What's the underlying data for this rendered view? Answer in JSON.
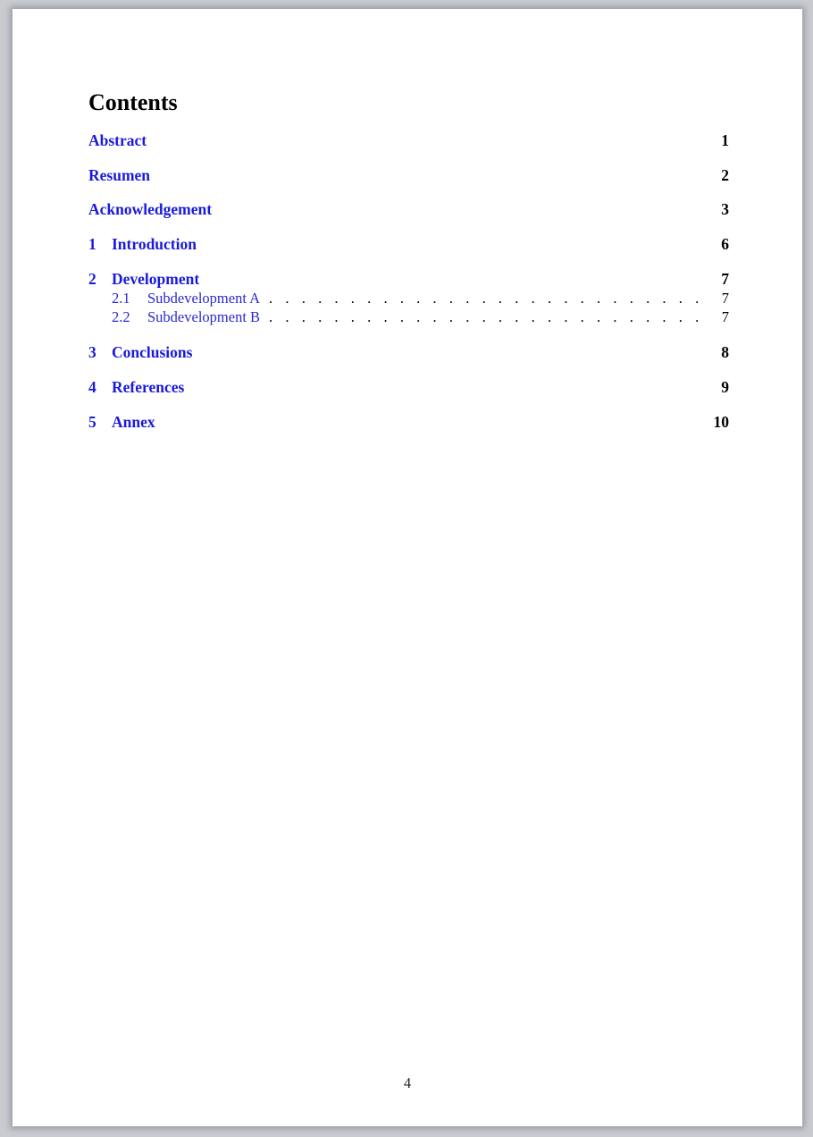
{
  "toc": {
    "title": "Contents",
    "entries": [
      {
        "num": "",
        "label": "Abstract",
        "page": "1"
      },
      {
        "num": "",
        "label": "Resumen",
        "page": "2"
      },
      {
        "num": "",
        "label": "Acknowledgement",
        "page": "3"
      },
      {
        "num": "1",
        "label": "Introduction",
        "page": "6"
      },
      {
        "num": "2",
        "label": "Development",
        "page": "7"
      },
      {
        "num": "3",
        "label": "Conclusions",
        "page": "8"
      },
      {
        "num": "4",
        "label": "References",
        "page": "9"
      },
      {
        "num": "5",
        "label": "Annex",
        "page": "10"
      }
    ],
    "sections": [
      {
        "num": "2.1",
        "label": "Subdevelopment A",
        "page": "7"
      },
      {
        "num": "2.2",
        "label": "Subdevelopment B",
        "page": "7"
      }
    ]
  },
  "footer": {
    "page_number": "4"
  },
  "colors": {
    "link": "#1a1adb",
    "text": "#000000",
    "page": "#ffffff",
    "background": "#c9cbd0"
  }
}
